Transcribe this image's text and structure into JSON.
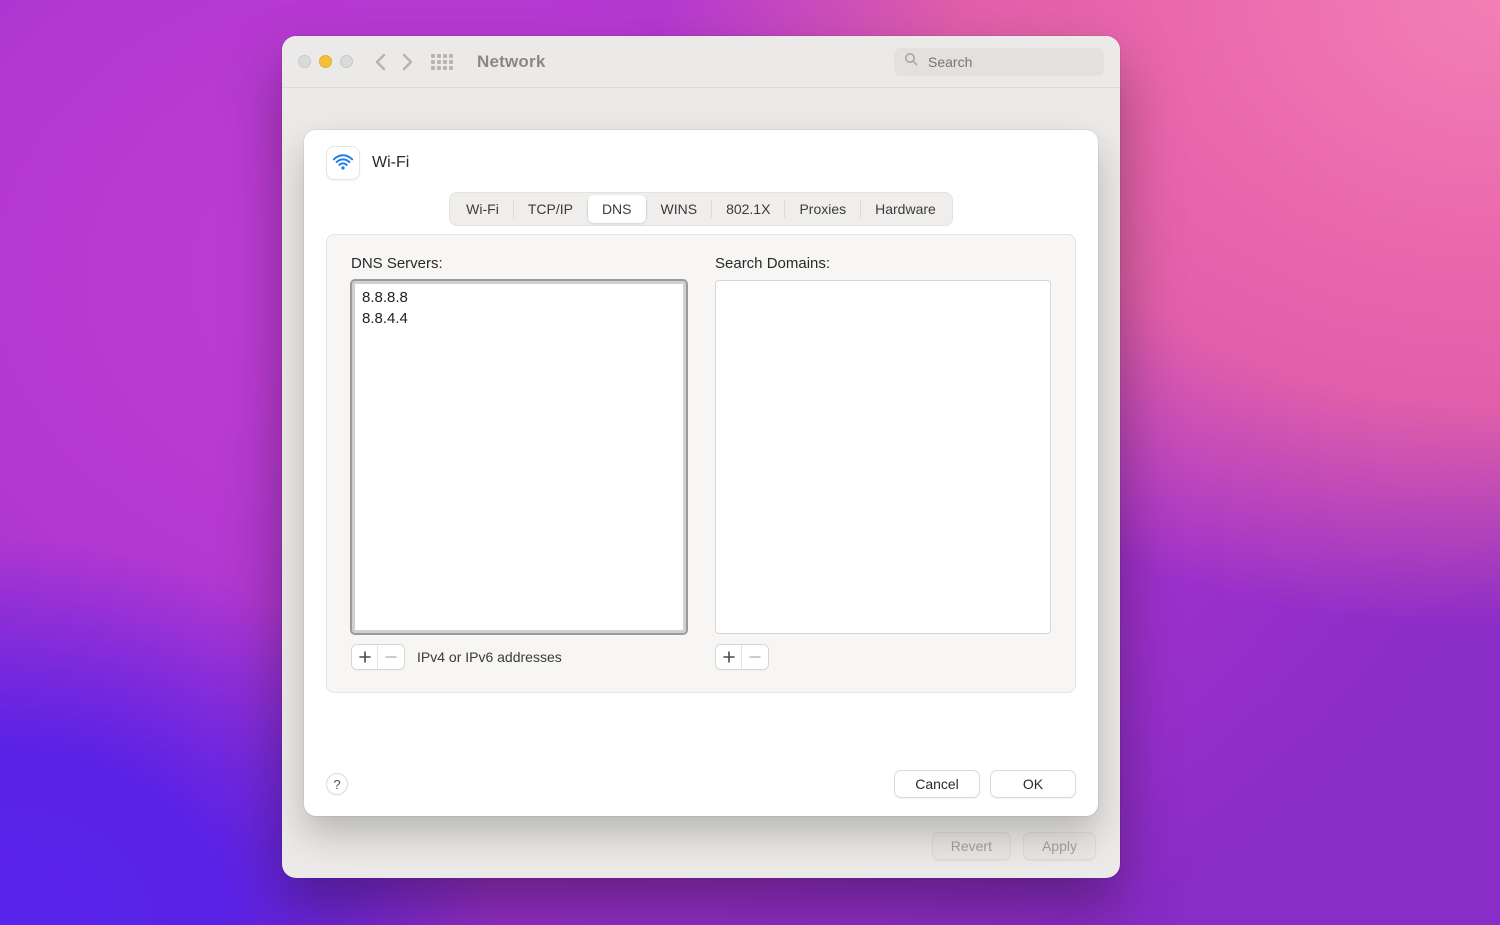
{
  "window": {
    "title": "Network",
    "search_placeholder": "Search"
  },
  "sheet": {
    "title": "Wi-Fi",
    "tabs": [
      {
        "label": "Wi-Fi"
      },
      {
        "label": "TCP/IP"
      },
      {
        "label": "DNS"
      },
      {
        "label": "WINS"
      },
      {
        "label": "802.1X"
      },
      {
        "label": "Proxies"
      },
      {
        "label": "Hardware"
      }
    ],
    "active_tab_index": 2,
    "dns": {
      "servers_label": "DNS Servers:",
      "servers": [
        "8.8.8.8",
        "8.8.4.4"
      ],
      "hint": "IPv4 or IPv6 addresses"
    },
    "domains": {
      "label": "Search Domains:",
      "items": []
    },
    "buttons": {
      "cancel": "Cancel",
      "ok": "OK"
    },
    "help": "?"
  },
  "parent_footer": {
    "revert": "Revert",
    "apply": "Apply"
  },
  "icons": {
    "wifi": "wifi-icon",
    "back": "chevron-left-icon",
    "forward": "chevron-right-icon",
    "grid": "grid-icon",
    "search": "search-icon",
    "plus": "plus-icon",
    "minus": "minus-icon",
    "help": "help-icon"
  }
}
